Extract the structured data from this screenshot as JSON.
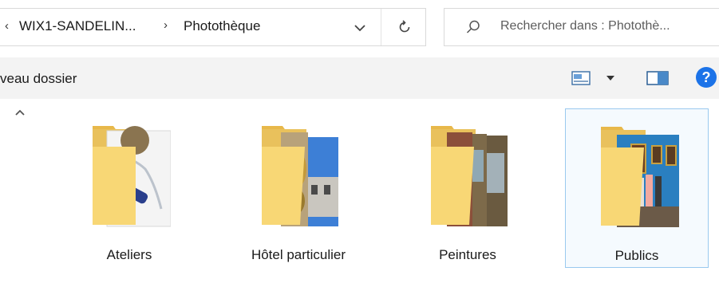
{
  "address": {
    "crumbs": [
      "WIX1-SANDELIN...",
      "Photothèque"
    ],
    "separator": "›"
  },
  "search": {
    "placeholder": "Rechercher dans : Photothè..."
  },
  "toolbar": {
    "new_folder_label": "veau dossier",
    "help_label": "?"
  },
  "folders": [
    {
      "label": "Ateliers",
      "selected": false
    },
    {
      "label": "Hôtel particulier",
      "selected": false
    },
    {
      "label": "Peintures",
      "selected": false
    },
    {
      "label": "Publics",
      "selected": true
    }
  ],
  "icons": {
    "address_left": "chevron-left-icon",
    "dropdown": "chevron-down-icon",
    "refresh": "refresh-icon",
    "search": "search-icon",
    "view": "view-options-icon",
    "preview_pane": "preview-pane-icon",
    "help": "help-icon",
    "scroll_up": "scroll-up-icon"
  },
  "colors": {
    "folder": "#f8d775",
    "selection_border": "#99c9ef",
    "help": "#1c73e8"
  }
}
